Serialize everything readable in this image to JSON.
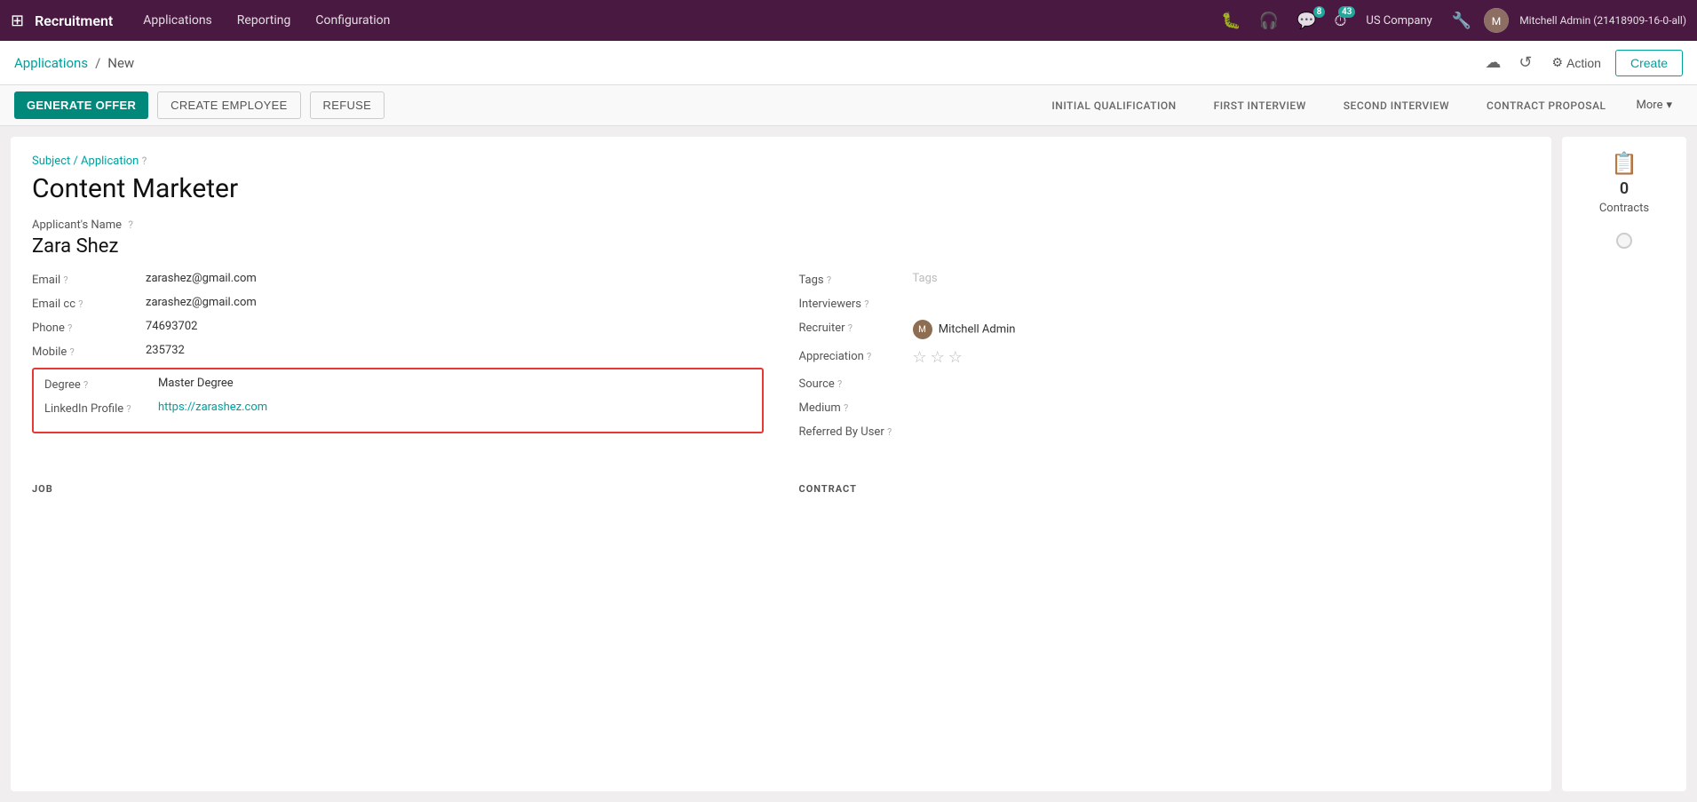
{
  "topnav": {
    "app_name": "Recruitment",
    "nav_items": [
      "Applications",
      "Reporting",
      "Configuration"
    ],
    "notifications_count": "8",
    "clock_count": "43",
    "company": "US Company",
    "user": "Mitchell Admin (21418909-16-0-all)"
  },
  "breadcrumb": {
    "parent": "Applications",
    "separator": "/",
    "current": "New"
  },
  "toolbar": {
    "action_label": "Action",
    "create_label": "Create"
  },
  "status_bar": {
    "generate_offer": "Generate Offer",
    "create_employee": "Create Employee",
    "refuse": "Refuse",
    "stages": [
      {
        "label": "Initial Qualification",
        "active": false
      },
      {
        "label": "First Interview",
        "active": false
      },
      {
        "label": "Second Interview",
        "active": false
      },
      {
        "label": "Contract Proposal",
        "active": false
      }
    ],
    "more_label": "More"
  },
  "right_panel": {
    "contracts_count": "0",
    "contracts_label": "Contracts"
  },
  "form": {
    "subject_label": "Subject / Application",
    "subject_help": "?",
    "title": "Content Marketer",
    "applicant_name_label": "Applicant's Name",
    "applicant_name_help": "?",
    "applicant_name": "Zara Shez",
    "fields_left": [
      {
        "label": "Email",
        "help": "?",
        "value": "zarashez@gmail.com"
      },
      {
        "label": "Email cc",
        "help": "?",
        "value": "zarashez@gmail.com"
      },
      {
        "label": "Phone",
        "help": "?",
        "value": "74693702"
      },
      {
        "label": "Mobile",
        "help": "?",
        "value": "235732"
      }
    ],
    "highlighted_fields": [
      {
        "label": "Degree",
        "help": "?",
        "value": "Master Degree"
      },
      {
        "label": "LinkedIn Profile",
        "help": "?",
        "value": "https://zarashez.com"
      }
    ],
    "fields_right": [
      {
        "label": "Tags",
        "help": "?",
        "value": "Tags",
        "placeholder": true
      },
      {
        "label": "Interviewers",
        "help": "?",
        "value": ""
      },
      {
        "label": "Recruiter",
        "help": "?",
        "value": "Mitchell Admin",
        "has_avatar": true
      },
      {
        "label": "Appreciation",
        "help": "?",
        "value": "stars"
      },
      {
        "label": "Source",
        "help": "?",
        "value": ""
      },
      {
        "label": "Medium",
        "help": "?",
        "value": ""
      },
      {
        "label": "Referred By User",
        "help": "?",
        "value": ""
      }
    ],
    "section_job": "JOB",
    "section_contract": "CONTRACT"
  }
}
